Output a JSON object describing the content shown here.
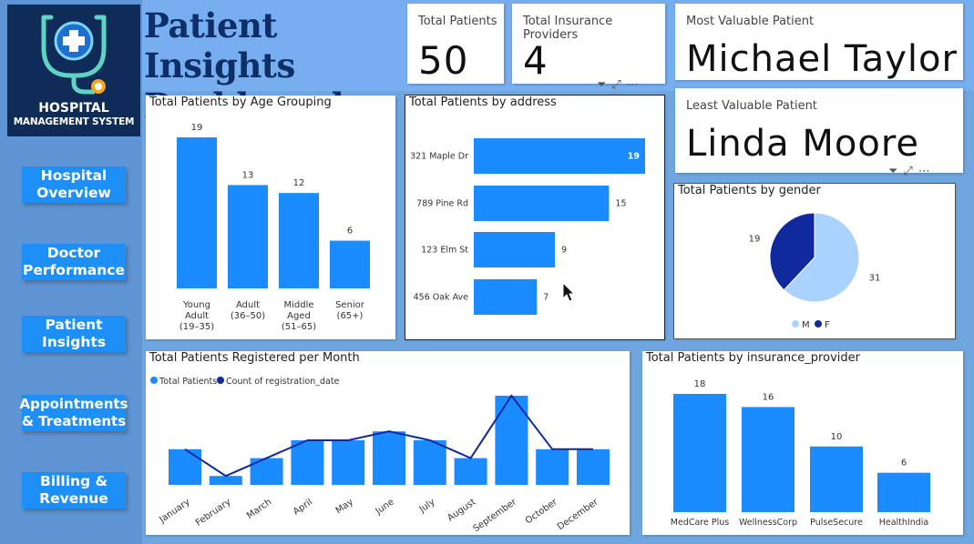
{
  "dashboard": {
    "title_line1": "Patient Insights",
    "title_line2": "Dashboard"
  },
  "logo": {
    "line1": "HOSPITAL",
    "line2": "MANAGEMENT SYSTEM",
    "icon": "stethoscope-cross-icon"
  },
  "nav": {
    "items": [
      {
        "line1": "Hospital",
        "line2": "Overview"
      },
      {
        "line1": "Doctor",
        "line2": "Performance"
      },
      {
        "line1": "Patient",
        "line2": "Insights"
      },
      {
        "line1": "Appointments",
        "line2": "& Treatments"
      },
      {
        "line1": "Billing &",
        "line2": "Revenue"
      }
    ]
  },
  "kpis": {
    "total_patients": {
      "label": "Total Patients",
      "value": "50"
    },
    "total_providers": {
      "label": "Total Insurance Providers",
      "value": "4"
    },
    "most_valuable": {
      "label": "Most Valuable Patient",
      "value": "Michael Taylor"
    },
    "least_valuable": {
      "label": "Least Valuable Patient",
      "value": "Linda Moore"
    }
  },
  "visual_toolbar": {
    "icons": [
      "filter-icon",
      "focus-mode-icon",
      "more-options-icon"
    ]
  },
  "colors": {
    "bar": "#1a8cff",
    "dark": "#102a9e",
    "light": "#a9d2ff",
    "title": "#0d2e66",
    "nav": "#1e8ff6"
  },
  "chart_data": [
    {
      "id": "age",
      "type": "bar",
      "title": "Total Patients by Age Grouping",
      "categories": [
        [
          "Young",
          "Adult",
          "(19–35)"
        ],
        [
          "Adult",
          "(36–50)"
        ],
        [
          "Middle",
          "Aged",
          "(51–65)"
        ],
        [
          "Senior",
          "(65+)"
        ]
      ],
      "values": [
        19,
        13,
        12,
        6
      ],
      "ylim": [
        0,
        19
      ]
    },
    {
      "id": "address",
      "type": "bar",
      "orientation": "horizontal",
      "title": "Total Patients by address",
      "categories": [
        "321 Maple Dr",
        "789 Pine Rd",
        "123 Elm St",
        "456 Oak Ave"
      ],
      "values": [
        19,
        15,
        9,
        7
      ],
      "xlim": [
        0,
        19
      ]
    },
    {
      "id": "gender",
      "type": "pie",
      "title": "Total Patients by gender",
      "slices": [
        {
          "label": "M",
          "value": 31,
          "color": "#a9d2ff"
        },
        {
          "label": "F",
          "value": 19,
          "color": "#102a9e"
        }
      ],
      "legend": "bottom"
    },
    {
      "id": "monthly",
      "type": "bar",
      "combo": "line",
      "title": "Total Patients Registered per Month",
      "categories": [
        "January",
        "February",
        "March",
        "April",
        "May",
        "June",
        "July",
        "August",
        "September",
        "October",
        "December"
      ],
      "series": [
        {
          "name": "Total Patients",
          "type": "bar",
          "values": [
            4,
            1,
            3,
            5,
            5,
            6,
            5,
            3,
            10,
            4,
            4
          ]
        },
        {
          "name": "Count of registration_date",
          "type": "line",
          "values": [
            4,
            1,
            3,
            5,
            5,
            6,
            5,
            3,
            10,
            4,
            4
          ]
        }
      ],
      "ylim": [
        0,
        10
      ],
      "legend": "top-left"
    },
    {
      "id": "insurance",
      "type": "bar",
      "title": "Total Patients by insurance_provider",
      "categories": [
        "MedCare Plus",
        "WellnessCorp",
        "PulseSecure",
        "HealthIndia"
      ],
      "values": [
        18,
        16,
        10,
        6
      ],
      "ylim": [
        0,
        18
      ]
    }
  ]
}
